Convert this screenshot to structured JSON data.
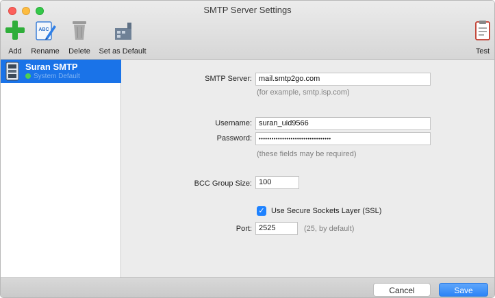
{
  "window": {
    "title": "SMTP Server Settings"
  },
  "toolbar": {
    "add_label": "Add",
    "rename_label": "Rename",
    "delete_label": "Delete",
    "set_default_label": "Set as Default",
    "test_label": "Test",
    "rename_icon_text": "ABC"
  },
  "sidebar": {
    "items": [
      {
        "name": "Suran SMTP",
        "subtitle": "System Default",
        "selected": true
      }
    ]
  },
  "form": {
    "smtp_server_label": "SMTP Server:",
    "smtp_server_value": "mail.smtp2go.com",
    "smtp_server_hint": "(for example, smtp.isp.com)",
    "username_label": "Username:",
    "username_value": "suran_uid9566",
    "password_label": "Password:",
    "password_value": "••••••••••••••••••••••••••••••••••",
    "credentials_hint": "(these fields may be required)",
    "bcc_label": "BCC Group Size:",
    "bcc_value": "100",
    "ssl_label": "Use Secure Sockets Layer (SSL)",
    "ssl_checked": true,
    "port_label": "Port:",
    "port_value": "2525",
    "port_hint": "(25, by default)"
  },
  "footer": {
    "cancel_label": "Cancel",
    "save_label": "Save"
  },
  "colors": {
    "selection": "#1a73e8",
    "accent": "#2b84f6",
    "default_dot": "#4fd04f"
  }
}
